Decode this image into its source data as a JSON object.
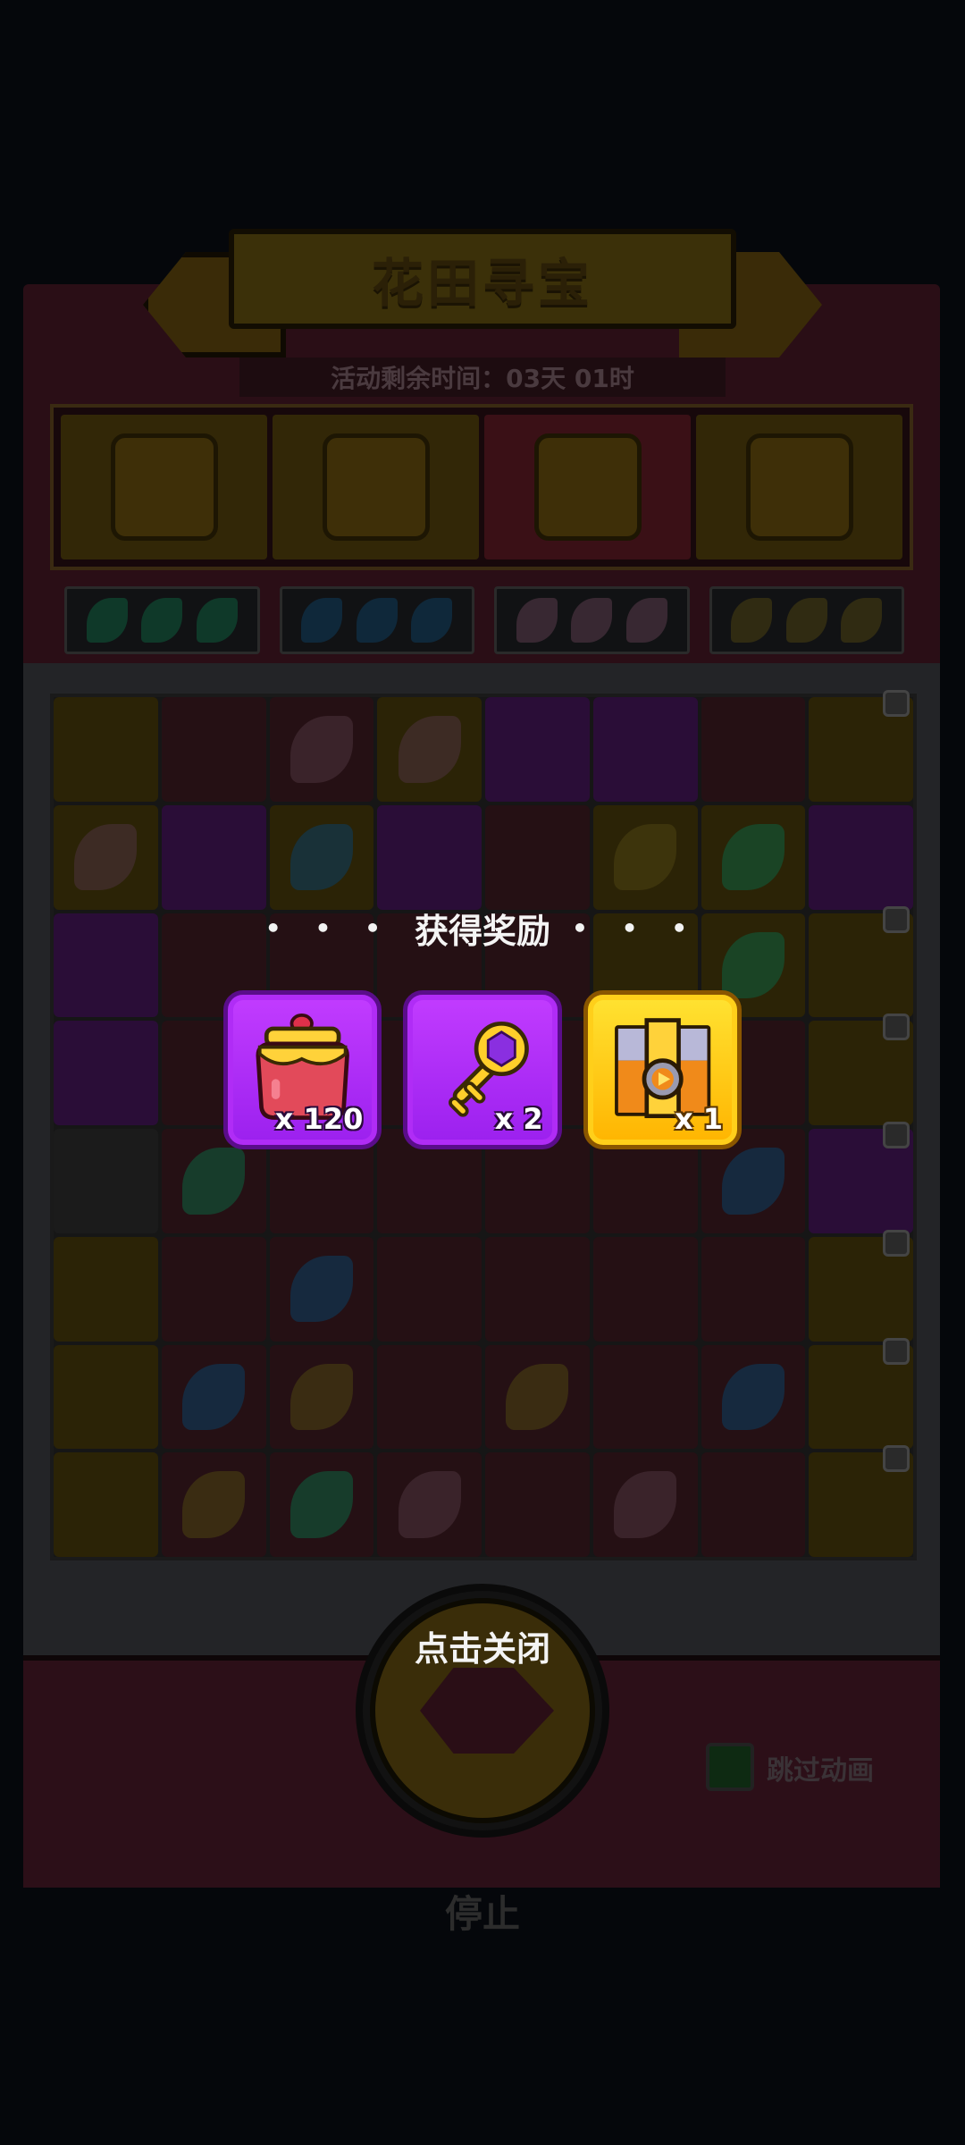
{
  "game": {
    "title": "花田寻宝",
    "timer": "活动剩余时间：03天 01时",
    "skip_animation_label": "跳过动画",
    "stop_label": "停止"
  },
  "overlay": {
    "title": "获得奖励",
    "dots_left": "• • •",
    "dots_right": "• • •",
    "rewards": [
      {
        "name": "honey-pot",
        "count": "x 120",
        "color": "#b02cf6"
      },
      {
        "name": "purple-key",
        "count": "x 2",
        "color": "#b02cf6"
      },
      {
        "name": "treasure-chest",
        "count": "x 1",
        "color": "#ffc40a"
      }
    ],
    "close_hint": "点击关闭"
  }
}
